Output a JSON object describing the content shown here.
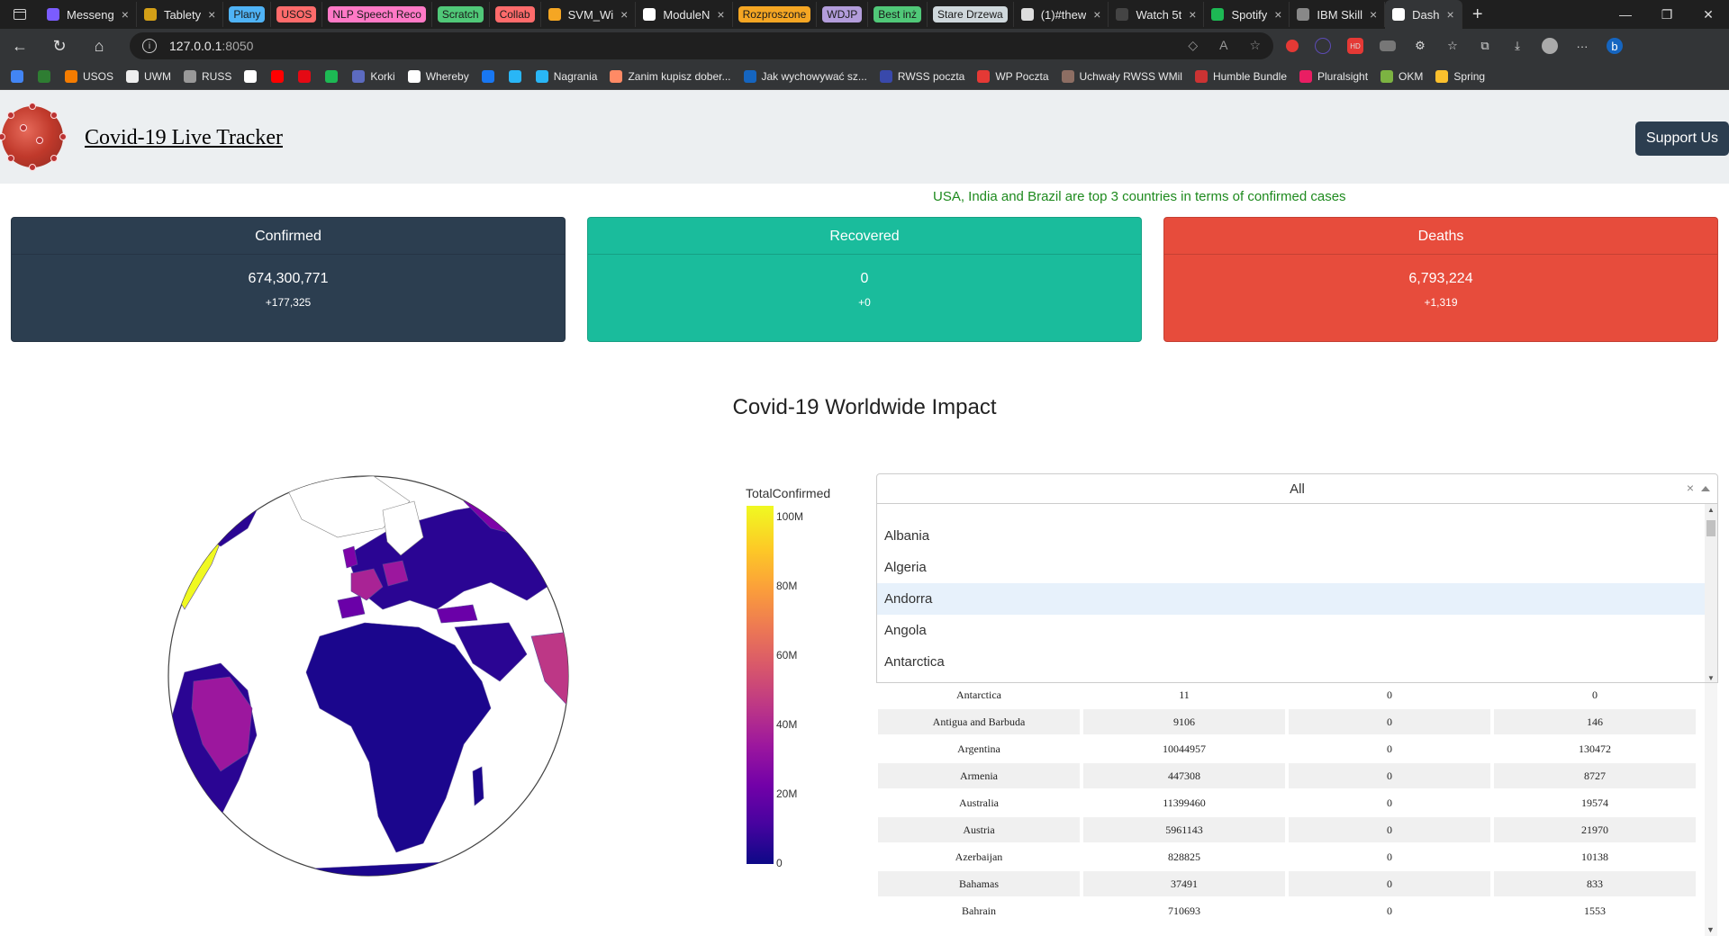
{
  "browser": {
    "tabs": [
      {
        "label": "Messeng",
        "color": "#7b5cff"
      },
      {
        "label": "Tablety",
        "color": "#d4a017"
      },
      {
        "label": "Plany",
        "pill": "#4fb3f6"
      },
      {
        "label": "USOS",
        "pill": "#ff6b6b"
      },
      {
        "label": "NLP Speech Reco",
        "pill": "#ff79c6"
      },
      {
        "label": "Scratch",
        "pill": "#50c878"
      },
      {
        "label": "Collab",
        "pill": "#ff6b6b"
      },
      {
        "label": "SVM_Wi",
        "color": "#f5a623"
      },
      {
        "label": "ModuleN",
        "color": "#ffffff"
      },
      {
        "label": "Rozproszone",
        "pill": "#f5a623"
      },
      {
        "label": "WDJP",
        "pill": "#b39ddb"
      },
      {
        "label": "Best inż",
        "pill": "#50c878"
      },
      {
        "label": "Stare Drzewa",
        "pill": "#cfd8dc"
      },
      {
        "label": "(1)#thew",
        "color": "#dddddd"
      },
      {
        "label": "Watch 5t",
        "color": "#444444"
      },
      {
        "label": "Spotify",
        "color": "#1db954"
      },
      {
        "label": "IBM Skill",
        "color": "#888888"
      },
      {
        "label": "Dash",
        "color": "#ffffff",
        "active": true
      }
    ],
    "url_host": "127.0.0.1",
    "url_port": ":8050",
    "bookmarks": [
      {
        "label": "",
        "color": "#4285f4"
      },
      {
        "label": "",
        "color": "#2e7d32"
      },
      {
        "label": "USOS",
        "color": "#f57c00"
      },
      {
        "label": "UWM",
        "color": "#eeeeee"
      },
      {
        "label": "RUSS",
        "color": "#999999"
      },
      {
        "label": "",
        "color": "#ffffff"
      },
      {
        "label": "",
        "color": "#ff0000"
      },
      {
        "label": "",
        "color": "#e50914"
      },
      {
        "label": "",
        "color": "#1db954"
      },
      {
        "label": "Korki",
        "color": "#5c6bc0"
      },
      {
        "label": "Whereby",
        "color": "#ffffff"
      },
      {
        "label": "",
        "color": "#1877f2"
      },
      {
        "label": "",
        "color": "#29b6f6"
      },
      {
        "label": "Nagrania",
        "color": "#29b6f6"
      },
      {
        "label": "Zanim kupisz dober...",
        "color": "#ff8a65"
      },
      {
        "label": "Jak wychowywać sz...",
        "color": "#1565c0"
      },
      {
        "label": "RWSS poczta",
        "color": "#3949ab"
      },
      {
        "label": "WP Poczta",
        "color": "#e53935"
      },
      {
        "label": "Uchwały RWSS WMil",
        "color": "#8d6e63"
      },
      {
        "label": "Humble Bundle",
        "color": "#cc3333"
      },
      {
        "label": "Pluralsight",
        "color": "#e91e63"
      },
      {
        "label": "OKM",
        "color": "#7cb342"
      },
      {
        "label": "Spring",
        "color": "#fbc02d"
      }
    ]
  },
  "page": {
    "title": "Covid-19 Live Tracker",
    "support_label": "Support Us",
    "top_note": "USA, India and Brazil are top 3 countries in terms of confirmed cases",
    "cards": [
      {
        "title": "Confirmed",
        "value": "674,300,771",
        "delta": "+177,325",
        "color": "#2c3e50"
      },
      {
        "title": "Recovered",
        "value": "0",
        "delta": "+0",
        "color": "#1abc9c"
      },
      {
        "title": "Deaths",
        "value": "6,793,224",
        "delta": "+1,319",
        "color": "#e74c3c"
      }
    ],
    "impact_title": "Covid-19 Worldwide Impact",
    "colorbar": {
      "title": "TotalConfirmed",
      "ticks": [
        "100M",
        "80M",
        "60M",
        "40M",
        "20M",
        "0"
      ]
    },
    "dropdown": {
      "value": "All",
      "options": [
        "Albania",
        "Algeria",
        "Andorra",
        "Angola",
        "Antarctica"
      ],
      "highlighted": "Andorra"
    },
    "table": {
      "rows": [
        [
          "Antarctica",
          "11",
          "0",
          "0"
        ],
        [
          "Antigua and Barbuda",
          "9106",
          "0",
          "146"
        ],
        [
          "Argentina",
          "10044957",
          "0",
          "130472"
        ],
        [
          "Armenia",
          "447308",
          "0",
          "8727"
        ],
        [
          "Australia",
          "11399460",
          "0",
          "19574"
        ],
        [
          "Austria",
          "5961143",
          "0",
          "21970"
        ],
        [
          "Azerbaijan",
          "828825",
          "0",
          "10138"
        ],
        [
          "Bahamas",
          "37491",
          "0",
          "833"
        ],
        [
          "Bahrain",
          "710693",
          "0",
          "1553"
        ]
      ]
    }
  }
}
